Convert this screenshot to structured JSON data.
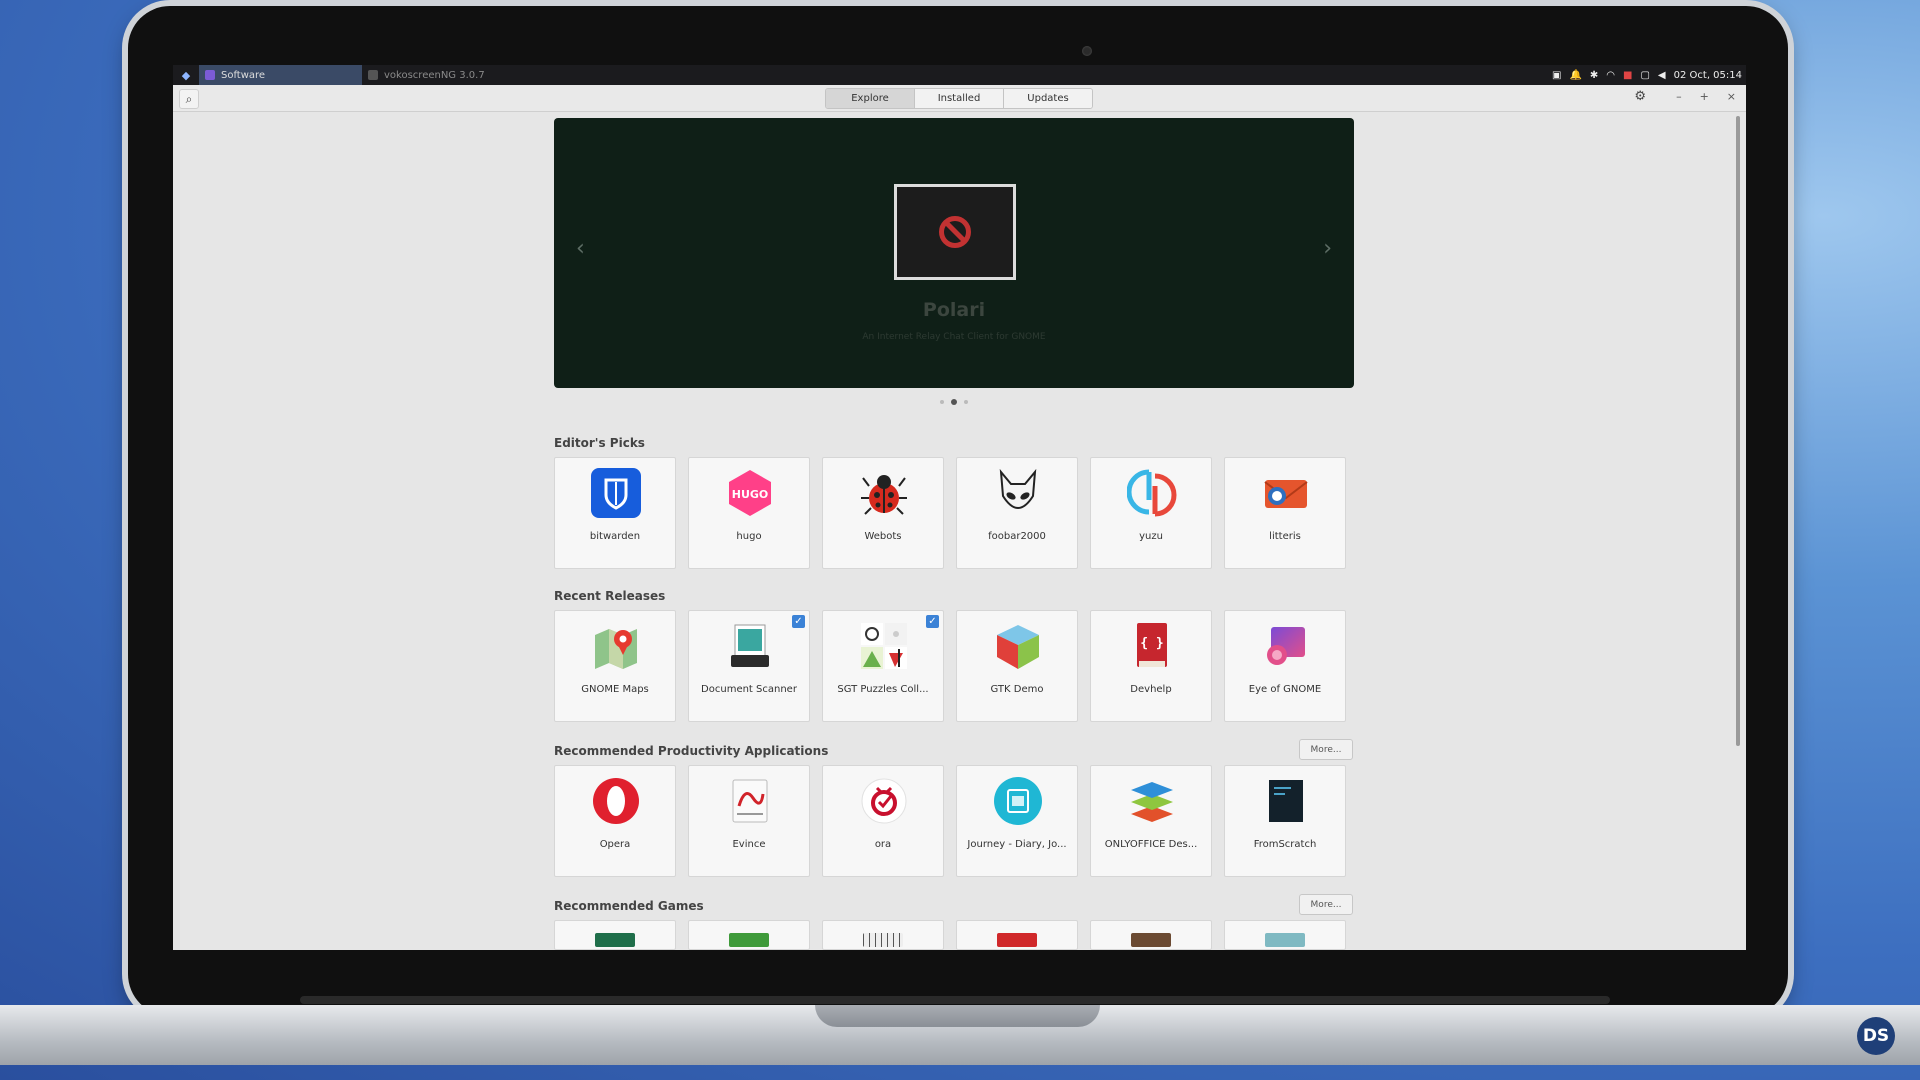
{
  "panel": {
    "active_task": "Software",
    "inactive_task": "vokoscreenNG 3.0.7",
    "clock": "02 Oct, 05:14"
  },
  "header": {
    "tabs": [
      {
        "label": "Explore",
        "active": true
      },
      {
        "label": "Installed",
        "active": false
      },
      {
        "label": "Updates",
        "active": false
      }
    ]
  },
  "banner": {
    "name": "Polari",
    "description": "An Internet Relay Chat Client for GNOME",
    "prev_arrow": "‹",
    "next_arrow": "›",
    "dot_count": 3,
    "active_dot": 1
  },
  "sections": {
    "editors_picks": {
      "title": "Editor's Picks",
      "apps": [
        {
          "name": "bitwarden",
          "icon": "bitwarden-icon"
        },
        {
          "name": "hugo",
          "icon": "hugo-icon"
        },
        {
          "name": "Webots",
          "icon": "ladybug-icon"
        },
        {
          "name": "foobar2000",
          "icon": "alien-icon"
        },
        {
          "name": "yuzu",
          "icon": "yuzu-icon"
        },
        {
          "name": "litteris",
          "icon": "litteris-icon"
        }
      ]
    },
    "recent_releases": {
      "title": "Recent Releases",
      "apps": [
        {
          "name": "GNOME Maps",
          "icon": "maps-icon",
          "installed": false
        },
        {
          "name": "Document Scanner",
          "icon": "scanner-icon",
          "installed": true
        },
        {
          "name": "SGT Puzzles Coll...",
          "icon": "puzzles-icon",
          "installed": true
        },
        {
          "name": "GTK Demo",
          "icon": "gtk-cube-icon",
          "installed": false
        },
        {
          "name": "Devhelp",
          "icon": "devhelp-icon",
          "installed": false
        },
        {
          "name": "Eye of GNOME",
          "icon": "image-viewer-icon",
          "installed": false
        }
      ]
    },
    "productivity": {
      "title": "Recommended Productivity Applications",
      "more_label": "More...",
      "apps": [
        {
          "name": "Opera",
          "icon": "opera-icon"
        },
        {
          "name": "Evince",
          "icon": "evince-icon"
        },
        {
          "name": "ora",
          "icon": "ora-icon"
        },
        {
          "name": "Journey - Diary, Jo...",
          "icon": "journey-icon"
        },
        {
          "name": "ONLYOFFICE Des...",
          "icon": "onlyoffice-icon"
        },
        {
          "name": "FromScratch",
          "icon": "fromscratch-icon"
        }
      ]
    },
    "games": {
      "title": "Recommended Games",
      "more_label": "More..."
    }
  },
  "badge": "DS",
  "colors": {
    "accent": "#3b82d6",
    "banner_bg": "#0f1f17",
    "panel_bg": "#1b1b1e"
  }
}
